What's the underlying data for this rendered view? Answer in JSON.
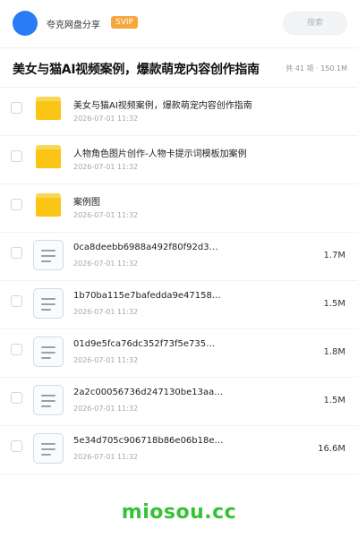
{
  "header": {
    "brand": "夸克网盘分享",
    "badge": "SVIP",
    "search_placeholder": "搜索"
  },
  "share": {
    "title": "美女与猫AI视频案例，爆款萌宠内容创作指南",
    "summary": "共 41 项 · 150.1M"
  },
  "files": [
    {
      "type": "folder",
      "name": "美女与猫AI视频案例，爆款萌宠内容创作指南",
      "date": "2026-07-01 11:32",
      "size": ""
    },
    {
      "type": "folder",
      "name": "人物角色图片创作-人物卡提示词模板加案例",
      "date": "2026-07-01 11:32",
      "size": ""
    },
    {
      "type": "folder",
      "name": "案例图",
      "date": "2026-07-01 11:32",
      "size": ""
    },
    {
      "type": "file",
      "name": "0ca8deebb6988a492f80f92d3…",
      "date": "2026-07-01 11:32",
      "size": "1.7M"
    },
    {
      "type": "file",
      "name": "1b70ba115e7bafedda9e47158…",
      "date": "2026-07-01 11:32",
      "size": "1.5M"
    },
    {
      "type": "file",
      "name": "01d9e5fca76dc352f73f5e735…",
      "date": "2026-07-01 11:32",
      "size": "1.8M"
    },
    {
      "type": "file",
      "name": "2a2c00056736d247130be13aa…",
      "date": "2026-07-01 11:32",
      "size": "1.5M"
    },
    {
      "type": "file",
      "name": "5e34d705c906718b86e06b18e…",
      "date": "2026-07-01 11:32",
      "size": "16.6M"
    }
  ],
  "watermark": "miosou.cc",
  "colors": {
    "avatar": "#2a7bf6",
    "svip_badge": "#f6a63a",
    "folder": "#fbc515",
    "watermark": "#35c235"
  },
  "icons": {
    "folder": "folder-icon",
    "file": "document-icon",
    "checkbox": "checkbox-icon"
  }
}
